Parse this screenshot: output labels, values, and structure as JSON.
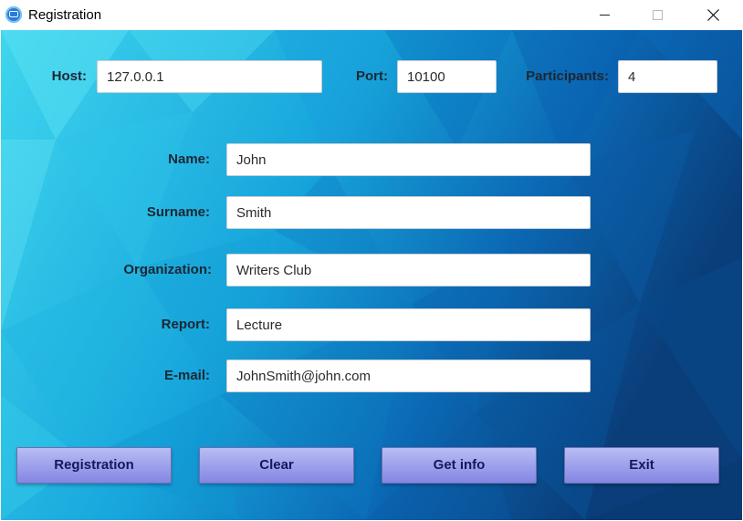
{
  "window": {
    "title": "Registration",
    "icon": "chat-bubble-icon"
  },
  "colors": {
    "bg_light": "#3fd6ee",
    "bg_dark": "#0a3e7a",
    "button_top": "#b8bdf3",
    "button_bottom": "#8486e4"
  },
  "connection": {
    "host_label": "Host:",
    "host_value": "127.0.0.1",
    "port_label": "Port:",
    "port_value": "10100",
    "participants_label": "Participants:",
    "participants_value": "4"
  },
  "form": {
    "name_label": "Name:",
    "name_value": "John",
    "surname_label": "Surname:",
    "surname_value": "Smith",
    "organization_label": "Organization:",
    "organization_value": "Writers Club",
    "report_label": "Report:",
    "report_value": "Lecture",
    "email_label": "E-mail:",
    "email_value": "JohnSmith@john.com"
  },
  "buttons": {
    "registration": "Registration",
    "clear": "Clear",
    "get_info": "Get info",
    "exit": "Exit"
  }
}
